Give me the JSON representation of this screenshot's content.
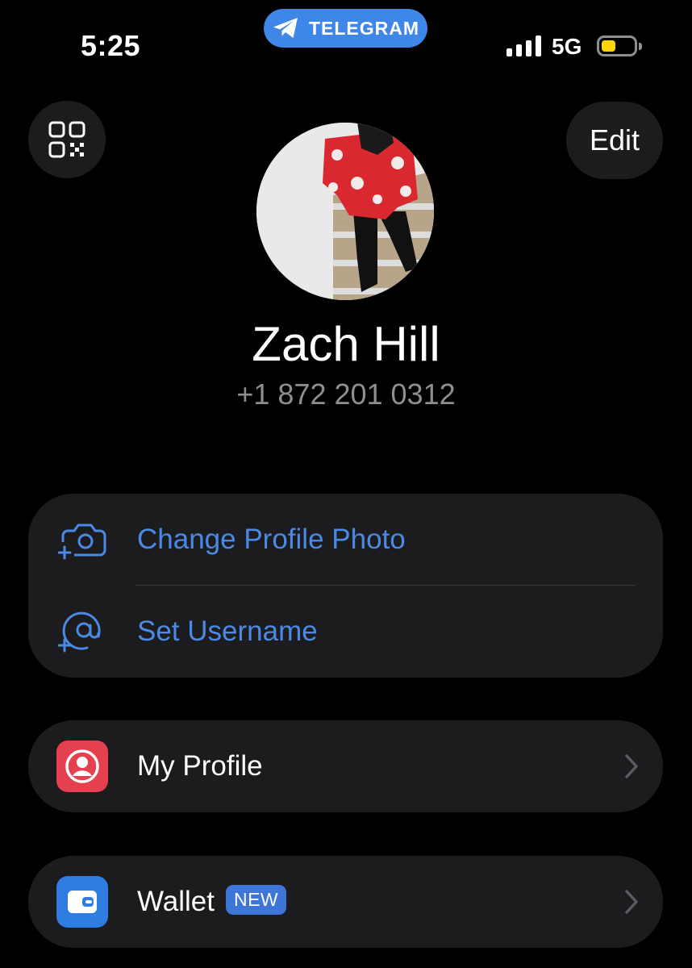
{
  "status_bar": {
    "time": "5:25",
    "app_pill": "TELEGRAM",
    "network": "5G",
    "battery_level": 0.3,
    "signal_bars": 4
  },
  "header": {
    "qr_icon": "qr-code-icon",
    "edit_label": "Edit"
  },
  "profile": {
    "name": "Zach Hill",
    "phone": "+1 872 201 0312"
  },
  "actions": [
    {
      "label": "Change Profile Photo",
      "icon": "add-camera-icon"
    },
    {
      "label": "Set Username",
      "icon": "add-at-sign-icon"
    }
  ],
  "menu": {
    "my_profile": {
      "label": "My Profile",
      "icon": "person-circle-icon",
      "color": "#e5404f"
    },
    "wallet": {
      "label": "Wallet",
      "badge": "NEW",
      "icon": "wallet-icon",
      "color": "#2f7de0"
    }
  },
  "colors": {
    "accent": "#4a8ae6",
    "card": "#1c1c1e",
    "pill": "#3e86e8"
  }
}
